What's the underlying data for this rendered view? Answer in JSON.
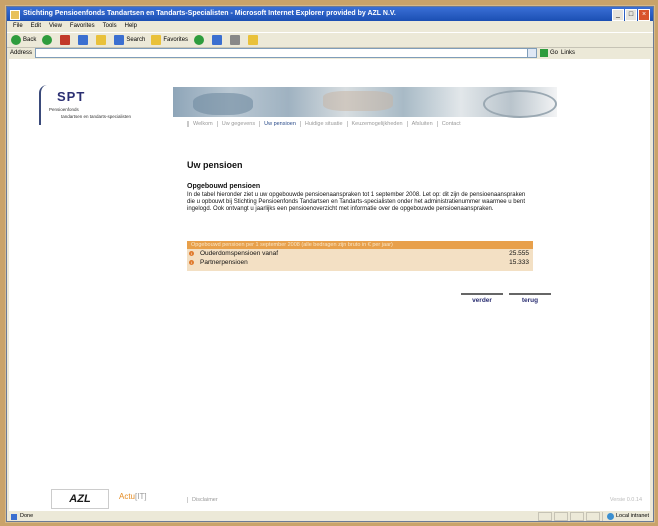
{
  "window": {
    "title": "Stichting Pensioenfonds Tandartsen en Tandarts-Specialisten - Microsoft Internet Explorer provided by AZL N.V."
  },
  "menu": [
    "File",
    "Edit",
    "View",
    "Favorites",
    "Tools",
    "Help"
  ],
  "toolbar": {
    "back_label": "Back",
    "search_label": "Search",
    "favorites_label": "Favorites"
  },
  "address": {
    "label": "Address",
    "go_label": "Go",
    "links_label": "Links"
  },
  "logo": {
    "name": "SPT",
    "line1": "Pensioenfonds",
    "line2": "tandartsen en tandarts-specialisten"
  },
  "nav": [
    "Welkom",
    "Uw gegevens",
    "Uw pensioen",
    "Huidige situatie",
    "Keuzemogelijkheden",
    "Afsluiten",
    "Contact"
  ],
  "page": {
    "title": "Uw pensioen",
    "subtitle": "Opgebouwd pensioen",
    "intro": "In de tabel hieronder ziet u uw opgebouwde pensioenaanspraken tot 1 september 2008. Let op: dit zijn de pensioenaanspraken die u opbouwt bij Stichting Pensioenfonds Tandartsen en Tandarts-specialisten onder het administratienummer waarmee u bent ingelogd. Ook ontvangt u jaarlijks een pensioenoverzicht met informatie over de opgebouwde pensioenaanspraken."
  },
  "pension_table": {
    "header": "Opgebouwd pensioen per 1 september 2008 (alle bedragen zijn bruto in € per jaar)",
    "rows": [
      {
        "label": "Ouderdomspensioen vanaf",
        "value": "25.555"
      },
      {
        "label": "Partnerpensioen",
        "value": "15.333"
      }
    ]
  },
  "buttons": {
    "verder": "verder",
    "terug": "terug"
  },
  "footer": {
    "azl": "AZL",
    "actuit_prefix": "Actu",
    "actuit_suffix": "[IT]",
    "disclaimer": "Disclaimer",
    "version": "Versie 0.0.14"
  },
  "status": {
    "text": "Done",
    "zone": "Local intranet"
  }
}
